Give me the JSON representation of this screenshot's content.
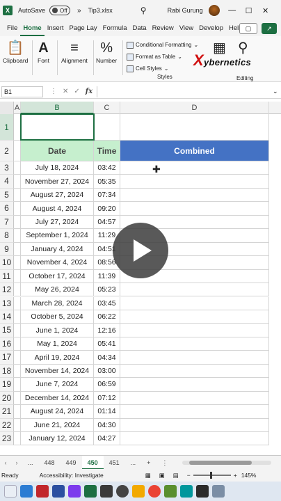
{
  "title_bar": {
    "app_icon": "X",
    "autosave_label": "AutoSave",
    "autosave_state": "Off",
    "overflow": "»",
    "filename": "Tip3.xlsx",
    "user_name": "Rabi Gurung",
    "minimize": "—",
    "maximize": "☐",
    "close": "✕"
  },
  "menu": {
    "tabs": [
      "File",
      "Home",
      "Insert",
      "Page Lay",
      "Formula",
      "Data",
      "Review",
      "View",
      "Develop",
      "Help"
    ],
    "active": "Home"
  },
  "ribbon": {
    "clipboard": "Clipboard",
    "font": "Font",
    "alignment": "Alignment",
    "number": "Number",
    "conditional_formatting": "Conditional Formatting",
    "format_as_table": "Format as Table",
    "cell_styles": "Cell Styles",
    "styles_group": "Styles",
    "editing": "Editing",
    "brand": "ybernetics",
    "brand_x": "X"
  },
  "formula_bar": {
    "name_box": "B1",
    "fx": "fx",
    "value": ""
  },
  "columns": [
    "A",
    "B",
    "C",
    "D"
  ],
  "headers": {
    "date": "Date",
    "time": "Time",
    "combined": "Combined"
  },
  "rows": [
    {
      "n": "1"
    },
    {
      "n": "2"
    },
    {
      "n": "3",
      "date": "July 18, 2024",
      "time": "03:42"
    },
    {
      "n": "4",
      "date": "November 27, 2024",
      "time": "05:35"
    },
    {
      "n": "5",
      "date": "August 27, 2024",
      "time": "07:34"
    },
    {
      "n": "6",
      "date": "August 4, 2024",
      "time": "09:20"
    },
    {
      "n": "7",
      "date": "July 27, 2024",
      "time": "04:57"
    },
    {
      "n": "8",
      "date": "September 1, 2024",
      "time": "11:29"
    },
    {
      "n": "9",
      "date": "January 4, 2024",
      "time": "04:51"
    },
    {
      "n": "10",
      "date": "November 4, 2024",
      "time": "08:56"
    },
    {
      "n": "11",
      "date": "October 17, 2024",
      "time": "11:39"
    },
    {
      "n": "12",
      "date": "May 26, 2024",
      "time": "05:23"
    },
    {
      "n": "13",
      "date": "March 28, 2024",
      "time": "03:45"
    },
    {
      "n": "14",
      "date": "October 5, 2024",
      "time": "06:22"
    },
    {
      "n": "15",
      "date": "June 1, 2024",
      "time": "12:16"
    },
    {
      "n": "16",
      "date": "May 1, 2024",
      "time": "05:41"
    },
    {
      "n": "17",
      "date": "April 19, 2024",
      "time": "04:34"
    },
    {
      "n": "18",
      "date": "November 14, 2024",
      "time": "03:00"
    },
    {
      "n": "19",
      "date": "June 7, 2024",
      "time": "06:59"
    },
    {
      "n": "20",
      "date": "December 14, 2024",
      "time": "07:12"
    },
    {
      "n": "21",
      "date": "August 24, 2024",
      "time": "01:14"
    },
    {
      "n": "22",
      "date": "June 21, 2024",
      "time": "04:30"
    },
    {
      "n": "23",
      "date": "January 12, 2024",
      "time": "04:27"
    }
  ],
  "sheet_tabs": {
    "prev": "‹",
    "next": "›",
    "ellipsis": "...",
    "tabs": [
      "448",
      "449",
      "450",
      "451"
    ],
    "active": "450",
    "add": "+",
    "more": "⋮"
  },
  "status_bar": {
    "ready": "Ready",
    "accessibility": "Accessibility: Investigate",
    "zoom": "145%"
  },
  "colors": {
    "excel_green": "#1d6f42",
    "date_header_fill": "#c6efce",
    "combined_header_fill": "#4472c4"
  }
}
